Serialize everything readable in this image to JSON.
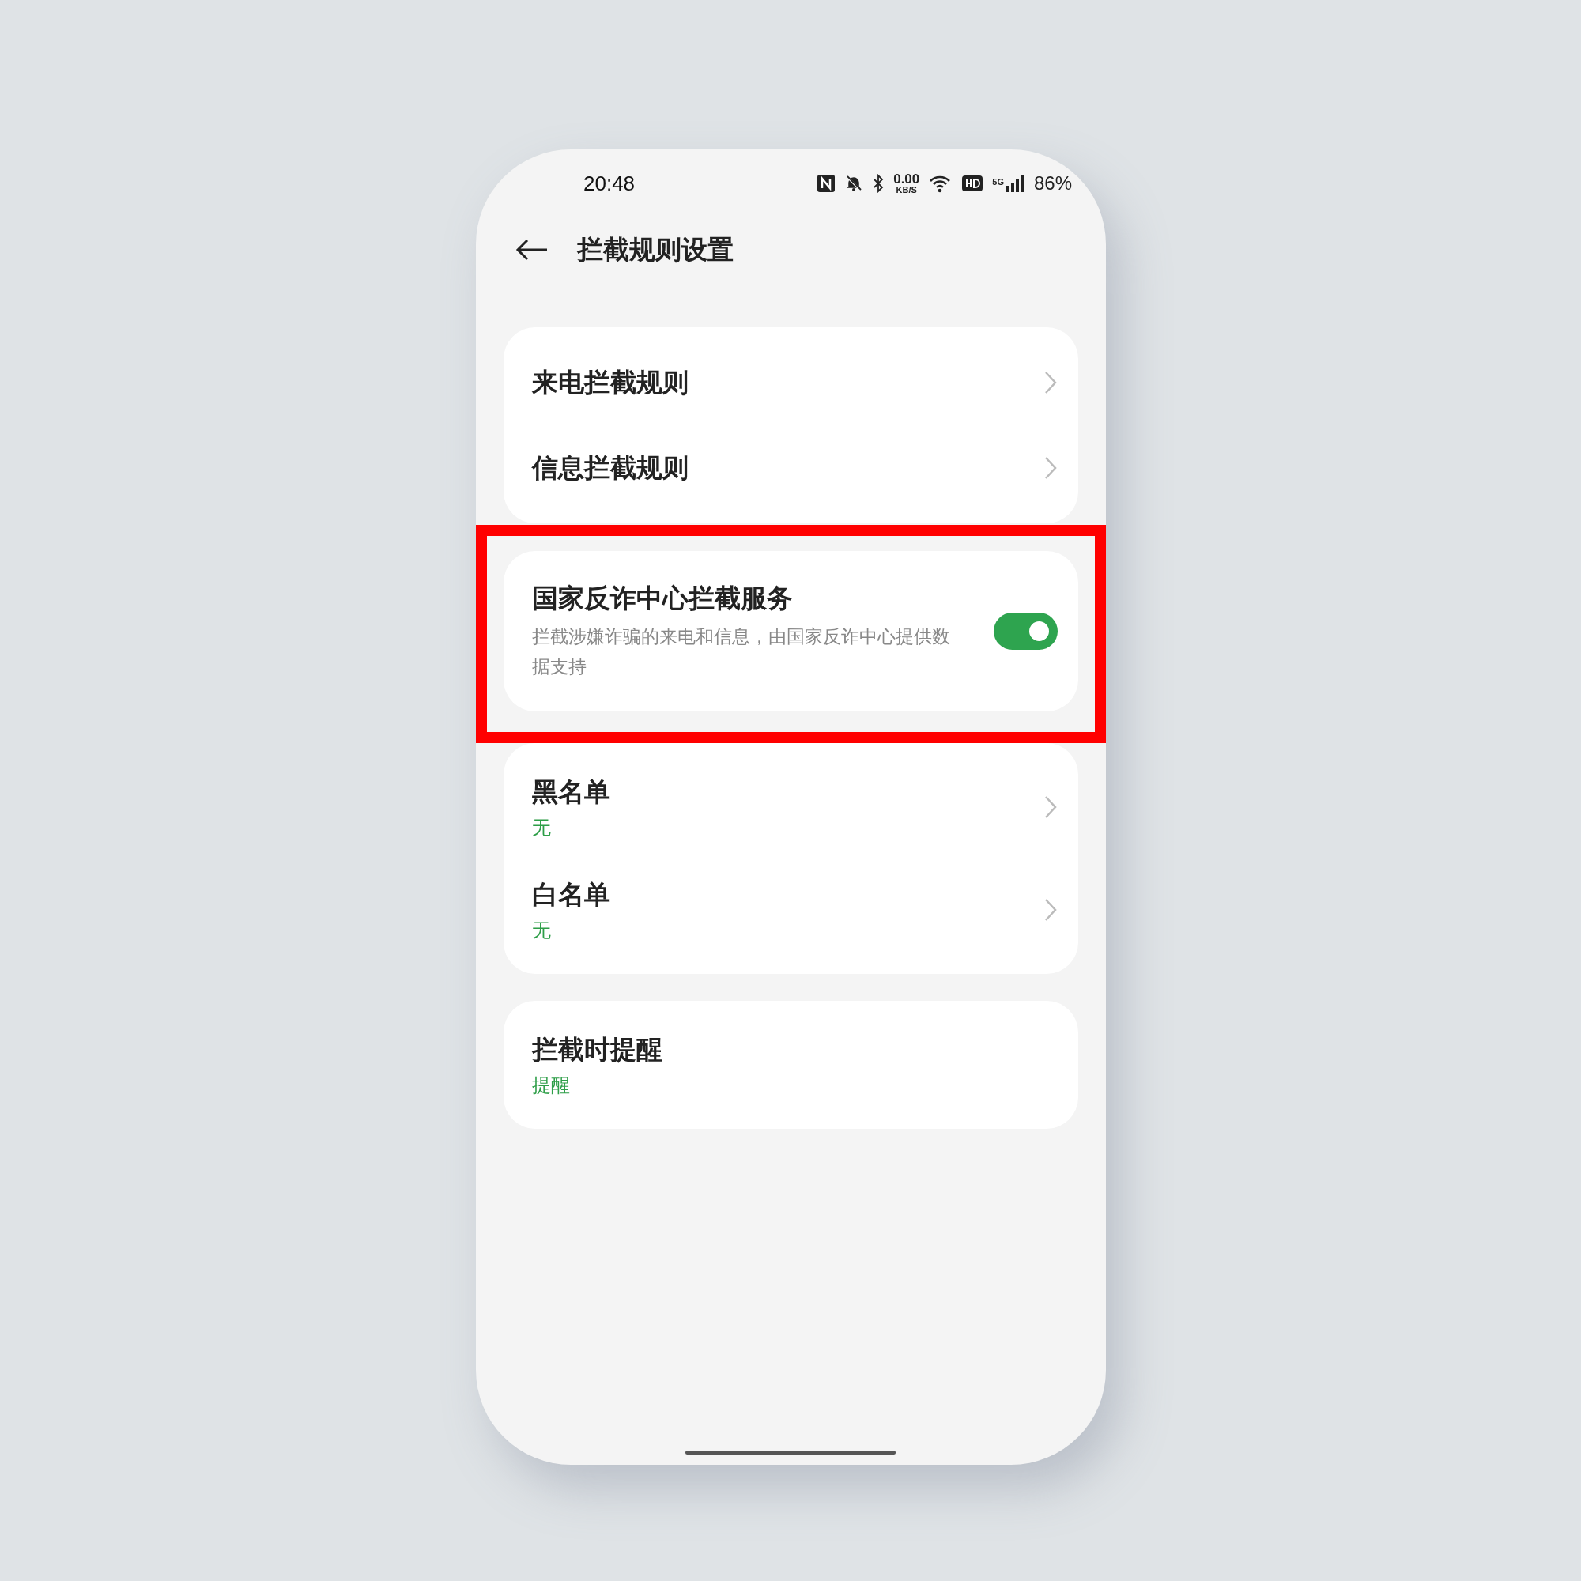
{
  "status_bar": {
    "time": "20:48",
    "speed_value": "0.00",
    "speed_unit": "KB/S",
    "network": "5G",
    "battery": "86%"
  },
  "header": {
    "title": "拦截规则设置"
  },
  "groups": [
    {
      "highlighted": false,
      "items": [
        {
          "kind": "link",
          "title": "来电拦截规则"
        },
        {
          "kind": "link",
          "title": "信息拦截规则"
        }
      ]
    },
    {
      "highlighted": true,
      "items": [
        {
          "kind": "toggle",
          "title": "国家反诈中心拦截服务",
          "description": "拦截涉嫌诈骗的来电和信息，由国家反诈中心提供数据支持",
          "on": true
        }
      ]
    },
    {
      "highlighted": false,
      "items": [
        {
          "kind": "link",
          "title": "黑名单",
          "value": "无"
        },
        {
          "kind": "link",
          "title": "白名单",
          "value": "无"
        }
      ]
    },
    {
      "highlighted": false,
      "items": [
        {
          "kind": "value",
          "title": "拦截时提醒",
          "value": "提醒"
        }
      ]
    }
  ]
}
